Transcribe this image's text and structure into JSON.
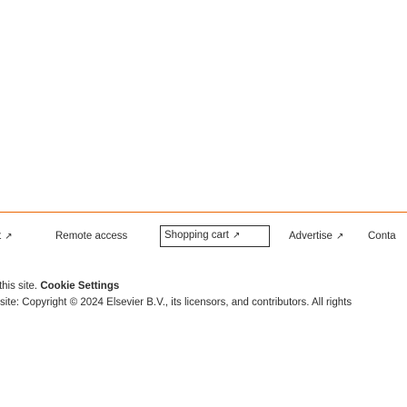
{
  "footer": {
    "links": [
      {
        "label": "t",
        "ext": "↗"
      },
      {
        "label": "Remote access",
        "ext": ""
      },
      {
        "label": "Shopping cart",
        "ext": "↗"
      },
      {
        "label": "Advertise",
        "ext": "↗"
      },
      {
        "label": "Conta",
        "ext": ""
      }
    ],
    "legal_line1": "y this site.",
    "cookie_settings": "Cookie Settings",
    "legal_line2": "site: Copyright © 2024 Elsevier B.V., its licensors, and contributors. All rights"
  },
  "colors": {
    "divider": "#eb6500",
    "text": "#2e2e2e"
  }
}
